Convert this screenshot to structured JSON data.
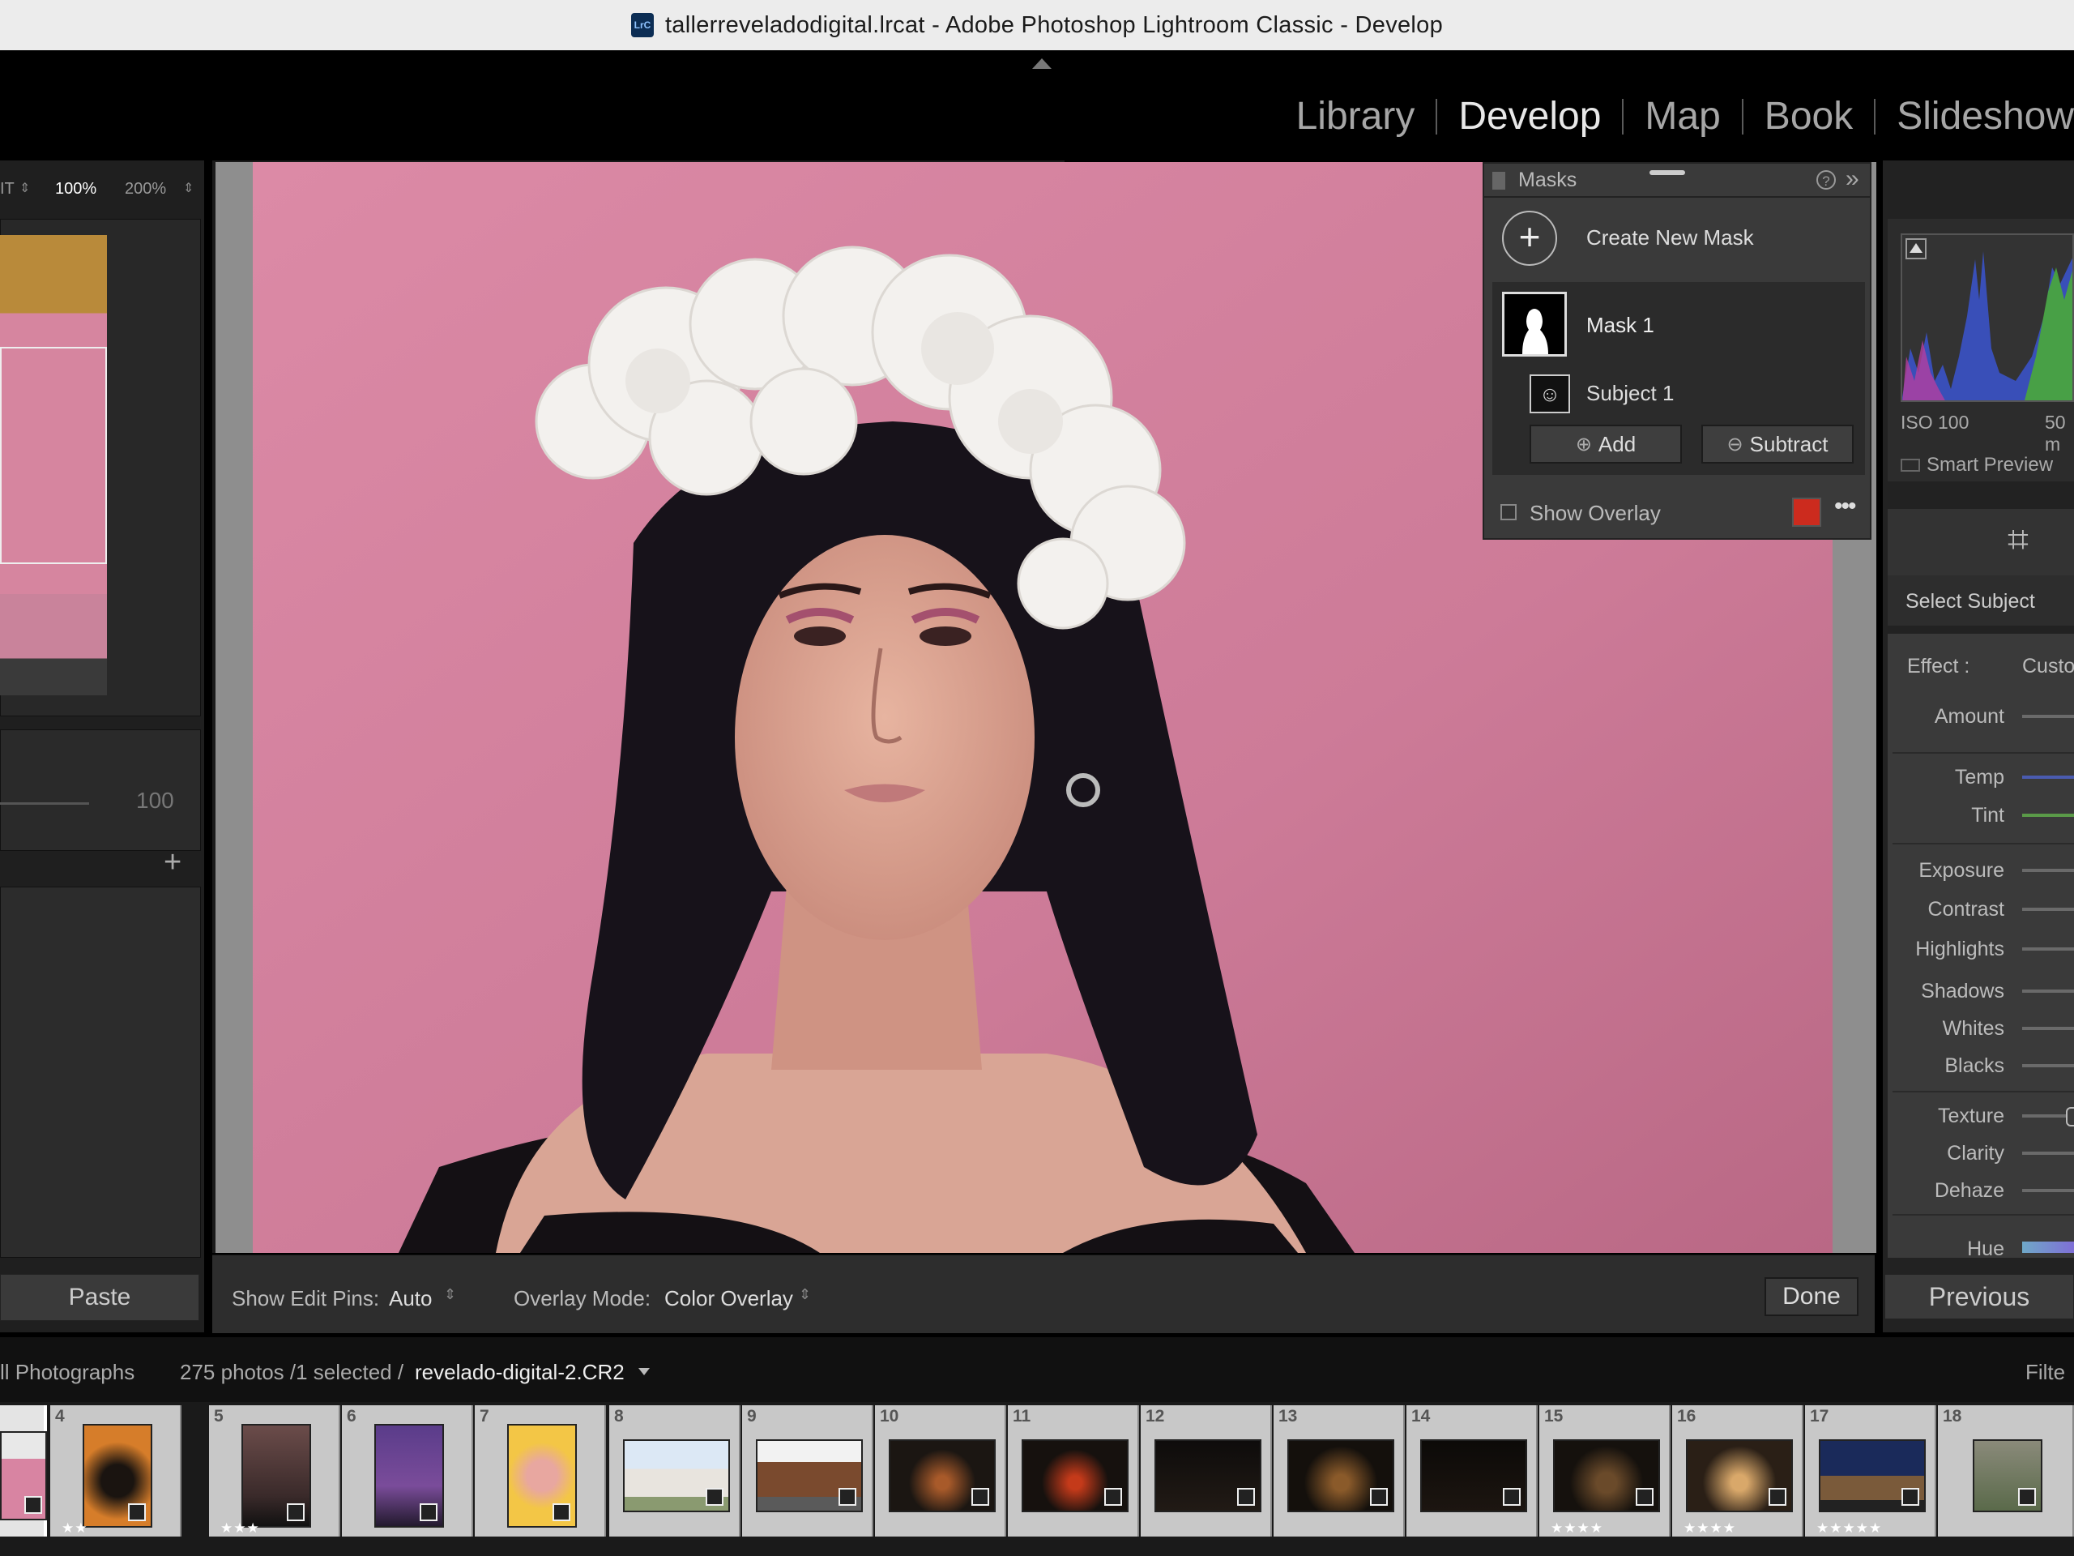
{
  "window": {
    "app_icon_text": "LrC",
    "title": "tallerreveladodigital.lrcat - Adobe Photoshop Lightroom Classic - Develop"
  },
  "modules": [
    "Library",
    "Develop",
    "Map",
    "Book",
    "Slideshow"
  ],
  "active_module": "Develop",
  "navigator": {
    "zoom_fit": "IT",
    "zoom_100": "100%",
    "zoom_200": "200%"
  },
  "left": {
    "value_100": "100",
    "paste_label": "Paste"
  },
  "masks": {
    "title": "Masks",
    "create_label": "Create New Mask",
    "mask_name": "Mask 1",
    "subject_name": "Subject 1",
    "add_label": "Add",
    "subtract_label": "Subtract",
    "show_overlay_label": "Show Overlay",
    "overlay_color": "#cc2b1e"
  },
  "histogram": {
    "iso": "ISO 100",
    "focal": "50 m",
    "smart_preview": "Smart Preview"
  },
  "mask_adjust": {
    "select_subject": "Select Subject",
    "effect_label": "Effect :",
    "effect_value": "Custo",
    "sliders": [
      "Amount",
      "Temp",
      "Tint",
      "Exposure",
      "Contrast",
      "Highlights",
      "Shadows",
      "Whites",
      "Blacks",
      "Texture",
      "Clarity",
      "Dehaze",
      "Hue"
    ]
  },
  "previous_label": "Previous",
  "toolbar": {
    "edit_pins_label": "Show Edit Pins:",
    "edit_pins_value": "Auto",
    "overlay_mode_label": "Overlay Mode:",
    "overlay_mode_value": "Color Overlay",
    "done_label": "Done"
  },
  "filmbar": {
    "source": "ll Photographs",
    "count": "275 photos /1 selected /",
    "filename": "revelado-digital-2.CR2",
    "filter": "Filte"
  },
  "filmstrip": [
    {
      "num": "",
      "stars": ""
    },
    {
      "num": "4",
      "stars": "★★"
    },
    {
      "num": "5",
      "stars": "★★★"
    },
    {
      "num": "6",
      "stars": ""
    },
    {
      "num": "7",
      "stars": ""
    },
    {
      "num": "8",
      "stars": ""
    },
    {
      "num": "9",
      "stars": ""
    },
    {
      "num": "10",
      "stars": ""
    },
    {
      "num": "11",
      "stars": ""
    },
    {
      "num": "12",
      "stars": ""
    },
    {
      "num": "13",
      "stars": ""
    },
    {
      "num": "14",
      "stars": ""
    },
    {
      "num": "15",
      "stars": "★★★★"
    },
    {
      "num": "16",
      "stars": "★★★★"
    },
    {
      "num": "17",
      "stars": "★★★★★"
    },
    {
      "num": "18",
      "stars": ""
    }
  ]
}
